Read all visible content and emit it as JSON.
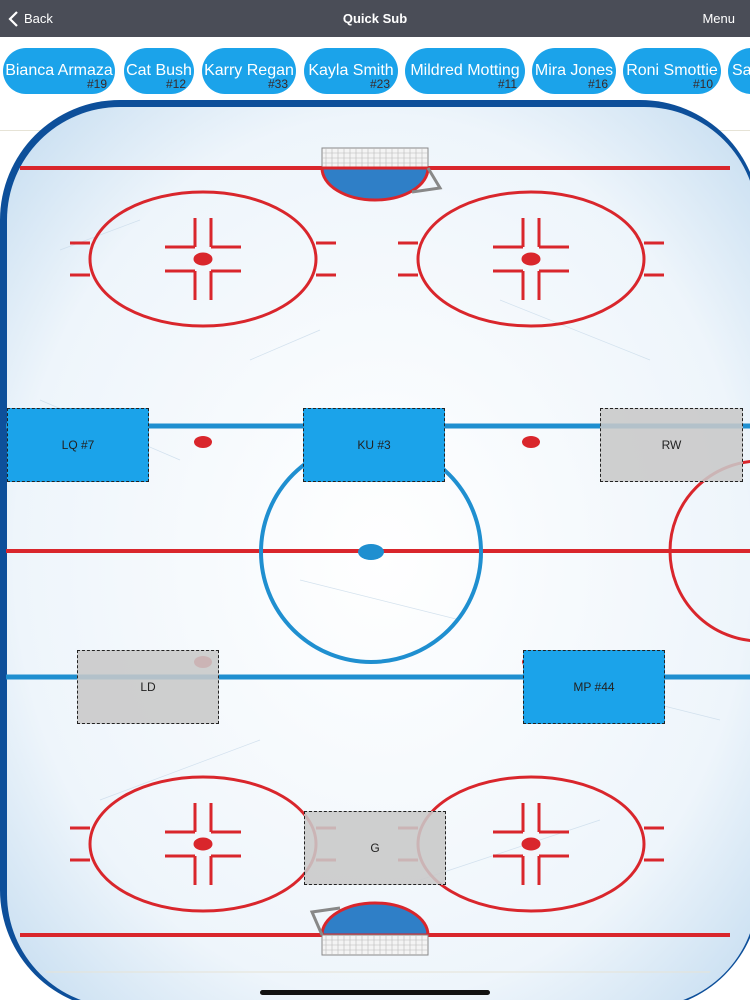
{
  "nav": {
    "back_label": "Back",
    "title": "Quick Sub",
    "menu_label": "Menu"
  },
  "roster": [
    {
      "name": "Bianca Armaza",
      "number": "#19"
    },
    {
      "name": "Cat Bush",
      "number": "#12"
    },
    {
      "name": "Karry Regan",
      "number": "#33"
    },
    {
      "name": "Kayla Smith",
      "number": "#23"
    },
    {
      "name": "Mildred Motting",
      "number": "#11"
    },
    {
      "name": "Mira Jones",
      "number": "#16"
    },
    {
      "name": "Roni Smottie",
      "number": "#10"
    },
    {
      "name": "Sa",
      "number": ""
    }
  ],
  "positions": {
    "lw": "LQ #7",
    "c": "KU #3",
    "rw": "RW",
    "ld": "LD",
    "rd": "MP #44",
    "g": "G"
  },
  "colors": {
    "nav_bg": "#4a4d57",
    "chip": "#1ba3ea",
    "rink_border": "#0d4f9a",
    "red_line": "#d9262c",
    "blue_line": "#1f8fd0"
  }
}
